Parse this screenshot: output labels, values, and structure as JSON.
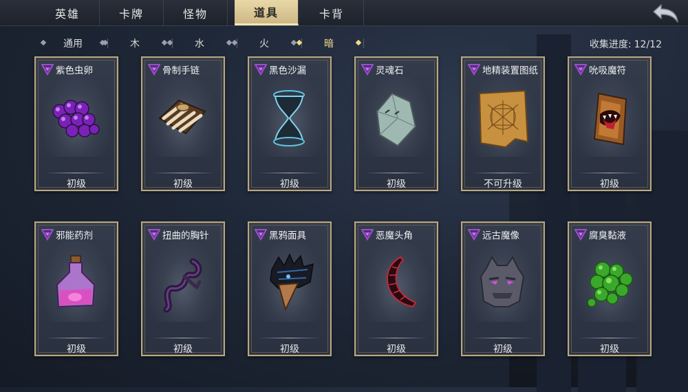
{
  "tabs": [
    {
      "label": "英雄",
      "active": false
    },
    {
      "label": "卡牌",
      "active": false
    },
    {
      "label": "怪物",
      "active": false
    },
    {
      "label": "道具",
      "active": true
    },
    {
      "label": "卡背",
      "active": false
    }
  ],
  "filters": [
    {
      "label": "通用",
      "active": false
    },
    {
      "label": "木",
      "active": false
    },
    {
      "label": "水",
      "active": false
    },
    {
      "label": "火",
      "active": false
    },
    {
      "label": "暗",
      "active": true
    }
  ],
  "progress": {
    "label": "收集进度:",
    "value": "12/12"
  },
  "colors": {
    "accent": "#f1d98c",
    "rank_icon": "#9b3fc9",
    "card_border": "#b8a888"
  },
  "items": [
    {
      "name": "紫色虫卵",
      "level": "初级",
      "icon": "purple-eggs-icon"
    },
    {
      "name": "骨制手链",
      "level": "初级",
      "icon": "bone-bracelet-icon"
    },
    {
      "name": "黑色沙漏",
      "level": "初级",
      "icon": "black-hourglass-icon"
    },
    {
      "name": "灵魂石",
      "level": "初级",
      "icon": "soul-stone-icon"
    },
    {
      "name": "地精装置图纸",
      "level": "不可升级",
      "icon": "goblin-blueprint-icon"
    },
    {
      "name": "吮吸魔符",
      "level": "初级",
      "icon": "sucking-rune-icon"
    },
    {
      "name": "邪能药剂",
      "level": "初级",
      "icon": "fel-potion-icon"
    },
    {
      "name": "扭曲的胸针",
      "level": "初级",
      "icon": "twisted-brooch-icon"
    },
    {
      "name": "黑鸦面具",
      "level": "初级",
      "icon": "raven-mask-icon"
    },
    {
      "name": "恶魔头角",
      "level": "初级",
      "icon": "demon-horn-icon"
    },
    {
      "name": "远古魔像",
      "level": "初级",
      "icon": "ancient-golem-icon"
    },
    {
      "name": "腐臭黏液",
      "level": "初级",
      "icon": "rotten-slime-icon"
    }
  ]
}
